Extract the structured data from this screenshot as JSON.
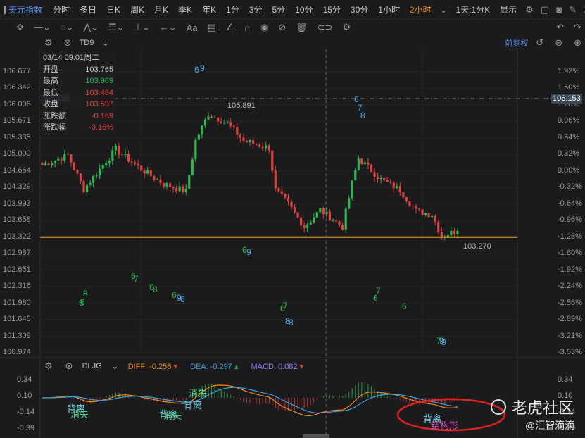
{
  "toolbar": {
    "symbol": "美元指数",
    "timeframes": [
      "分时",
      "多日",
      "日K",
      "周K",
      "月K",
      "季K",
      "年K",
      "1分",
      "3分",
      "5分",
      "10分",
      "15分",
      "30分",
      "1小时",
      "2小时"
    ],
    "active": "2小时",
    "range": "1天:1分K",
    "display": "显示"
  },
  "indicator_header": {
    "name": "TD9",
    "adjust": "前复权"
  },
  "info": {
    "datetime": "03/14 09:01周二",
    "rows": [
      {
        "label": "开盘",
        "value": "103.765",
        "color": "#c8c8c8"
      },
      {
        "label": "最高",
        "value": "103.969",
        "color": "#2db84d"
      },
      {
        "label": "最低",
        "value": "103.484",
        "color": "#e0403e"
      },
      {
        "label": "收盘",
        "value": "103.597",
        "color": "#e0403e"
      },
      {
        "label": "涨跌额",
        "value": "-0.169",
        "color": "#e0403e"
      },
      {
        "label": "涨跌幅",
        "value": "-0.16%",
        "color": "#e0403e"
      }
    ]
  },
  "price_axis": [
    "106.677",
    "106.342",
    "106.006",
    "105.671",
    "105.335",
    "105.000",
    "104.664",
    "104.329",
    "103.993",
    "103.658",
    "103.322",
    "102.987",
    "102.651",
    "102.316",
    "101.980",
    "101.645",
    "101.309",
    "100.974"
  ],
  "pct_axis": [
    "1.92%",
    "1.60%",
    "1.28%",
    "0.96%",
    "0.64%",
    "0.32%",
    "0.00%",
    "-0.32%",
    "-0.64%",
    "-0.96%",
    "-1.28%",
    "-1.60%",
    "-1.92%",
    "-2.24%",
    "-2.56%",
    "-2.89%",
    "-3.21%",
    "-3.53%"
  ],
  "crosshair_price": "106.153",
  "high_label": "105.891",
  "low_label": "103.270",
  "support_line_price": 103.322,
  "chart_data": {
    "type": "candlestick",
    "ylim": [
      100.974,
      106.677
    ],
    "close_keypoints": [
      [
        0,
        104.78
      ],
      [
        8,
        104.99
      ],
      [
        13,
        104.3
      ],
      [
        23,
        105.1
      ],
      [
        31,
        104.7
      ],
      [
        38,
        104.4
      ],
      [
        45,
        104.25
      ],
      [
        48,
        105.28
      ],
      [
        52,
        105.82
      ],
      [
        58,
        105.63
      ],
      [
        63,
        105.28
      ],
      [
        71,
        105.13
      ],
      [
        73,
        104.28
      ],
      [
        77,
        103.99
      ],
      [
        82,
        103.53
      ],
      [
        87,
        103.87
      ],
      [
        94,
        103.53
      ],
      [
        97,
        104.42
      ],
      [
        99,
        104.92
      ],
      [
        106,
        104.49
      ],
      [
        112,
        104.28
      ],
      [
        117,
        103.85
      ],
      [
        122,
        103.78
      ],
      [
        125,
        103.35
      ],
      [
        130,
        103.45
      ]
    ]
  },
  "td9_markers": [
    "6",
    "9",
    "6",
    "7",
    "8",
    "6",
    "9",
    "6",
    "7",
    "6",
    "8",
    "6",
    "8",
    "6",
    "9",
    "7",
    "8",
    "6",
    "7",
    "6",
    "8",
    "9",
    "6",
    "7",
    "6",
    "6",
    "9"
  ],
  "macd": {
    "name": "DLJG",
    "diff_label": "DIFF:",
    "diff": "-0.256",
    "dea_label": "DEA:",
    "dea": "-0.297",
    "macd_label": "MACD:",
    "macd": "0.082",
    "axis": [
      "0.34",
      "0.10",
      "-0.14",
      "-0.39"
    ],
    "signals": [
      "背离",
      "消失",
      "背离",
      "消失",
      "消失",
      "背离",
      "背离",
      "结构形"
    ]
  },
  "colors": {
    "up": "#2db84d",
    "down": "#e0403e",
    "diff": "#f08a1c",
    "dea": "#3aa0d8",
    "support": "#f0a020"
  },
  "watermark": {
    "brand": "老虎社区",
    "author": "@汇智滴滴"
  }
}
